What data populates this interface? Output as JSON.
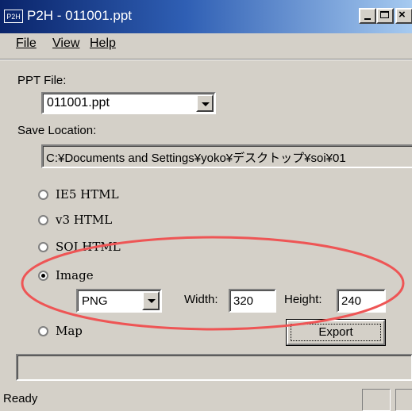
{
  "window": {
    "icon_label": "P2H",
    "title": "P2H - 011001.ppt",
    "close_glyph": "×"
  },
  "menu": {
    "file_label": "File",
    "view_label": "View",
    "help_label": "Help"
  },
  "form": {
    "ppt_file_label": "PPT File:",
    "ppt_file_value": "011001.ppt",
    "save_location_label": "Save Location:",
    "save_location_value": "C:¥Documents and Settings¥yoko¥デスクトップ¥soi¥01",
    "output_options": [
      {
        "label": "IE5 HTML",
        "selected": false
      },
      {
        "label": "v3 HTML",
        "selected": false
      },
      {
        "label": "SOI HTML",
        "selected": false
      },
      {
        "label": "Image",
        "selected": true
      },
      {
        "label": "Map",
        "selected": false
      }
    ],
    "image_format": "PNG",
    "width_label": "Width:",
    "width_value": "320",
    "height_label": "Height:",
    "height_value": "240",
    "export_label": "Export"
  },
  "status": {
    "text": "Ready"
  },
  "annotation": {
    "highlight_color": "#ee5555"
  }
}
